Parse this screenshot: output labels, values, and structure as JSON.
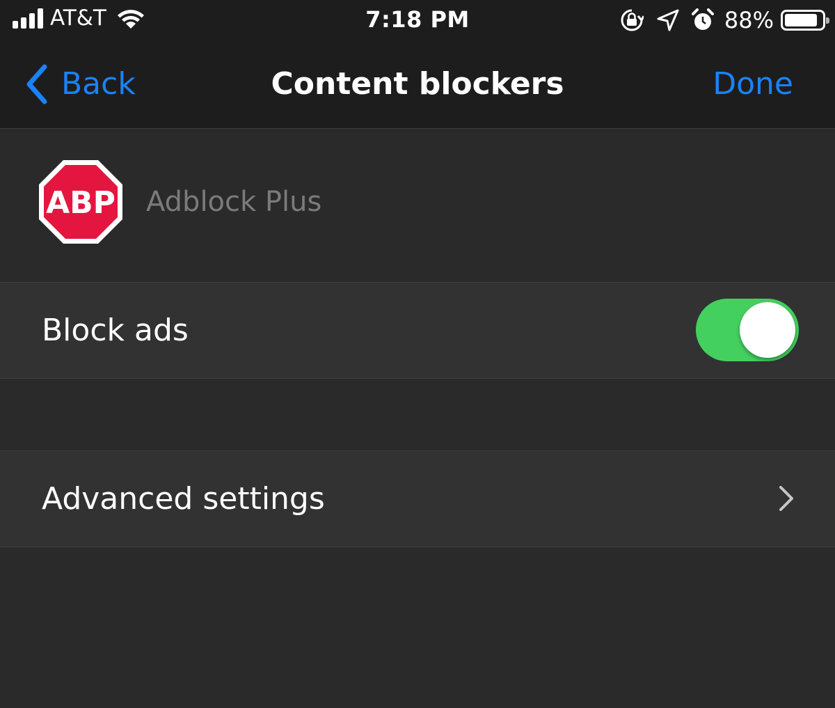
{
  "status_bar": {
    "carrier": "AT&T",
    "time": "7:18 PM",
    "battery_percent": "88%",
    "battery_level": 0.88,
    "icons": [
      "signal-icon",
      "wifi-icon",
      "orientation-lock-icon",
      "location-icon",
      "alarm-icon",
      "battery-icon"
    ]
  },
  "nav": {
    "back_label": "Back",
    "title": "Content blockers",
    "done_label": "Done"
  },
  "app": {
    "logo_text": "ABP",
    "name": "Adblock Plus"
  },
  "settings": {
    "block_ads_label": "Block ads",
    "block_ads_enabled": true,
    "advanced_label": "Advanced settings"
  },
  "colors": {
    "accent": "#1a82fb",
    "toggle_on": "#44d05e",
    "logo_red": "#e4163f",
    "background": "#2a2a2a",
    "bar_background": "#1d1d1d"
  }
}
